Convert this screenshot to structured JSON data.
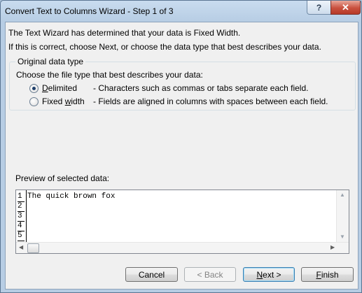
{
  "window": {
    "title": "Convert Text to Columns Wizard - Step 1 of 3",
    "help_label": "?",
    "close_label": "✕"
  },
  "intro": {
    "line1": "The Text Wizard has determined that your data is Fixed Width.",
    "line2": "If this is correct, choose Next, or choose the data type that best describes your data."
  },
  "data_type": {
    "group_title": "Original data type",
    "prompt": "Choose the file type that best describes your data:",
    "options": [
      {
        "label_pre": "",
        "label_mnemonic": "D",
        "label_post": "elimited",
        "description": "- Characters such as commas or tabs separate each field.",
        "selected": true
      },
      {
        "label_pre": "Fixed ",
        "label_mnemonic": "w",
        "label_post": "idth",
        "description": "- Fields are aligned in columns with spaces between each field.",
        "selected": false
      }
    ]
  },
  "preview": {
    "label": "Preview of selected data:",
    "line_numbers": [
      "1",
      "2",
      "3",
      "4",
      "5"
    ],
    "text": "The quick brown fox"
  },
  "buttons": {
    "cancel": "Cancel",
    "back": "< Back",
    "next_pre": "",
    "next_mnemonic": "N",
    "next_post": "ext >",
    "finish_pre": "",
    "finish_mnemonic": "F",
    "finish_post": "inish"
  }
}
